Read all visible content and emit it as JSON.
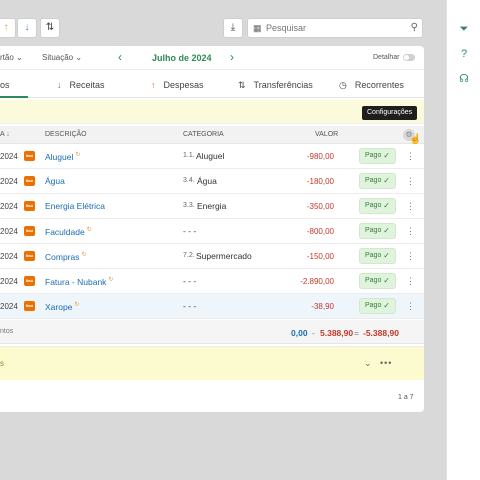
{
  "toolbar": {
    "up_arrow_icon": "arrow-up",
    "down_arrow_icon": "arrow-down",
    "sort_icon": "sort",
    "download_icon": "download",
    "search_placeholder": "Pesquisar"
  },
  "filters": {
    "account_filter": "rtão",
    "status_filter": "Situação",
    "month": "Julho de 2024",
    "detail_label": "Detalhar"
  },
  "tabs": [
    {
      "label": "os"
    },
    {
      "label": "Receitas"
    },
    {
      "label": "Despesas"
    },
    {
      "label": "Transferências"
    },
    {
      "label": "Recorrentes"
    }
  ],
  "tooltip": "Configurações",
  "table": {
    "headers": {
      "date": "A",
      "description": "DESCRIÇÃO",
      "category": "CATEGORIA",
      "value": "VALOR"
    },
    "rows": [
      {
        "date": "2024",
        "bank": "Itaú",
        "description": "Aluguel",
        "cat_num": "1.1.",
        "cat_name": "Aluguel",
        "value": "-980,00",
        "status": "Pago"
      },
      {
        "date": "2024",
        "bank": "Itaú",
        "description": "Água",
        "cat_num": "3.4.",
        "cat_name": "Água",
        "value": "-180,00",
        "status": "Pago"
      },
      {
        "date": "2024",
        "bank": "Itaú",
        "description": "Energia Elétrica",
        "cat_num": "3.3.",
        "cat_name": "Energia",
        "value": "-350,00",
        "status": "Pago"
      },
      {
        "date": "2024",
        "bank": "Itaú",
        "description": "Faculdade",
        "cat_num": "",
        "cat_name": "- - -",
        "value": "-800,00",
        "status": "Pago"
      },
      {
        "date": "2024",
        "bank": "Itaú",
        "description": "Compras",
        "cat_num": "7.2.",
        "cat_name": "Supermercado",
        "value": "-150,00",
        "status": "Pago"
      },
      {
        "date": "2024",
        "bank": "Itaú",
        "description": "Fatura - Nubank",
        "cat_num": "",
        "cat_name": "- - -",
        "value": "-2.890,00",
        "status": "Pago"
      },
      {
        "date": "2024",
        "bank": "Itaú",
        "description": "Xarope",
        "cat_num": "",
        "cat_name": "- - -",
        "value": "-38,90",
        "status": "Pago"
      }
    ]
  },
  "totals": {
    "label": "ntos",
    "income": "0,00",
    "minus": "-",
    "expense": "5.388,90",
    "equals": "=",
    "balance": "-5.388,90"
  },
  "yellow_bar": {
    "text": "s"
  },
  "pagination": "1 a 7",
  "colors": {
    "accent": "#2e8b57",
    "expense": "#c0392b",
    "link": "#1a6db3",
    "bank": "#ec7000"
  }
}
